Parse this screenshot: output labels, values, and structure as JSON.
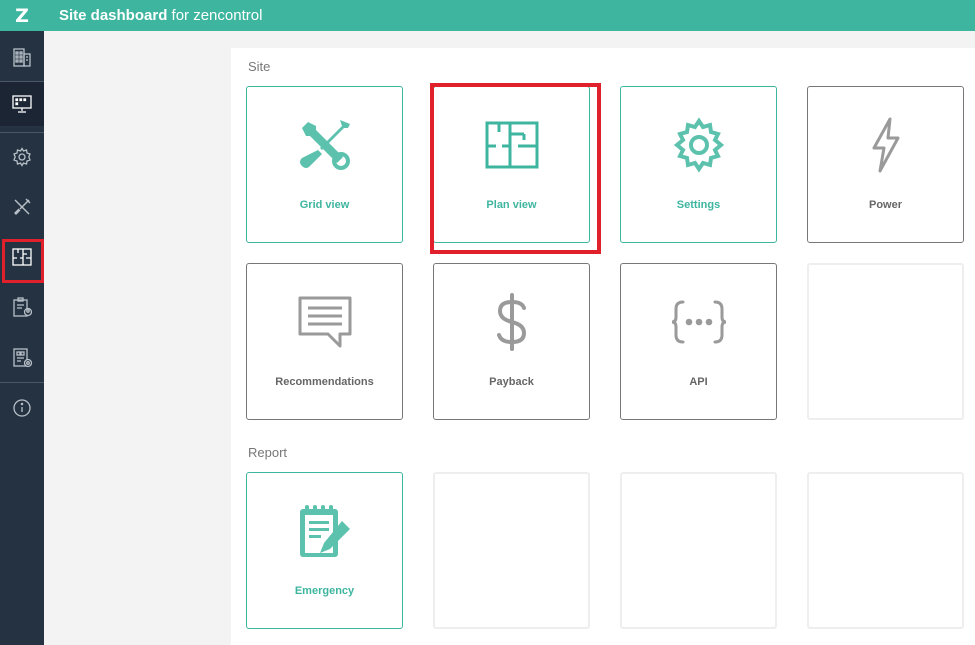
{
  "header": {
    "logo": "Z",
    "title_bold": "Site dashboard",
    "title_rest": " for zencontrol"
  },
  "sidebar": {
    "items": [
      {
        "icon": "building-icon"
      },
      {
        "icon": "monitor-icon",
        "active": true
      },
      {
        "icon": "gear-icon"
      },
      {
        "icon": "tools-icon"
      },
      {
        "icon": "floorplan-icon",
        "highlighted": true
      },
      {
        "icon": "clipboard-user-icon"
      },
      {
        "icon": "report-settings-icon"
      },
      {
        "icon": "info-icon"
      }
    ]
  },
  "sections": {
    "site": {
      "label": "Site",
      "tiles": [
        {
          "label": "Grid view",
          "icon": "tools-icon",
          "style": "green"
        },
        {
          "label": "Plan view",
          "icon": "floorplan-icon",
          "style": "green",
          "highlighted": true
        },
        {
          "label": "Settings",
          "icon": "gear-icon",
          "style": "green"
        },
        {
          "label": "Power",
          "icon": "lightning-icon",
          "style": "grey"
        },
        {
          "label": "Recommendations",
          "icon": "chat-icon",
          "style": "grey"
        },
        {
          "label": "Payback",
          "icon": "dollar-icon",
          "style": "grey"
        },
        {
          "label": "API",
          "icon": "braces-icon",
          "style": "grey"
        }
      ]
    },
    "report": {
      "label": "Report",
      "tiles": [
        {
          "label": "Emergency",
          "icon": "notepad-pencil-icon",
          "style": "green"
        }
      ]
    }
  },
  "colors": {
    "accent": "#3eb59f",
    "sidebar": "#253241",
    "highlight": "#e0202a",
    "grey_icon": "#9a9a9a"
  }
}
